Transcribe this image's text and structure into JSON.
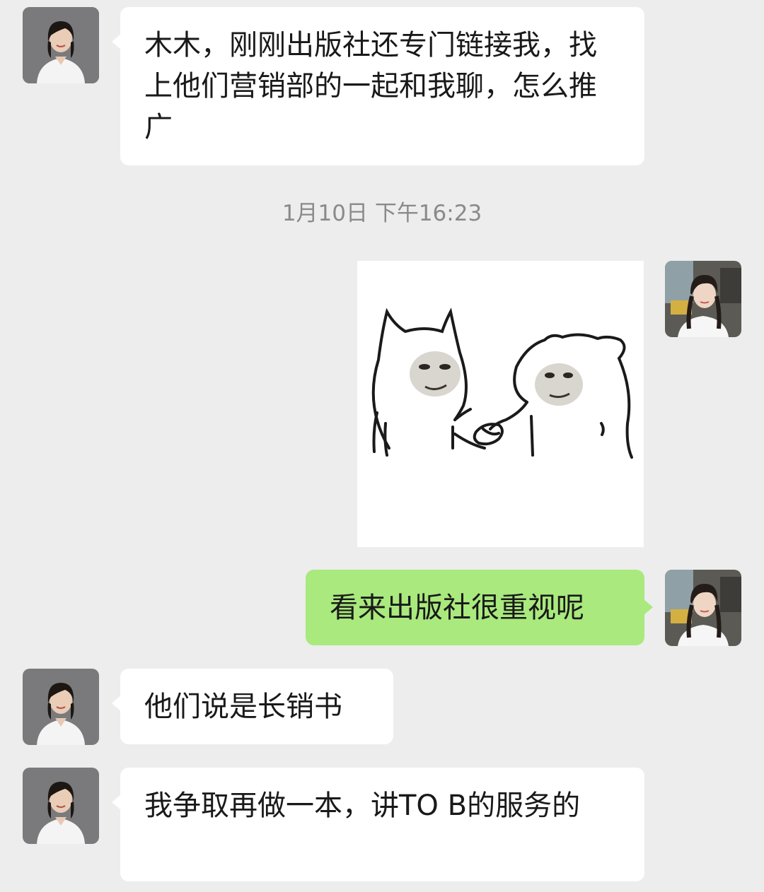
{
  "messages": [
    {
      "side": "left",
      "text": "木木，刚刚出版社还专门链接我，找上他们营销部的一起和我聊，怎么推广"
    },
    {
      "side": "right",
      "type": "sticker",
      "sticker": "two-cats-handshake-meme-sticker"
    },
    {
      "side": "right",
      "text": "看来出版社很重视呢"
    },
    {
      "side": "left",
      "text": "他们说是长销书"
    },
    {
      "side": "left",
      "text": "我争取再做一本，讲TO B的服务的"
    }
  ],
  "timestamp": "1月10日 下午16:23",
  "colors": {
    "background": "#ededed",
    "incoming_bubble": "#ffffff",
    "outgoing_bubble": "#a9e97d",
    "timestamp_text": "#8a8a8a"
  },
  "icons": {
    "contact_avatar": "woman-white-shirt-avatar",
    "self_avatar": "girl-braids-avatar"
  }
}
